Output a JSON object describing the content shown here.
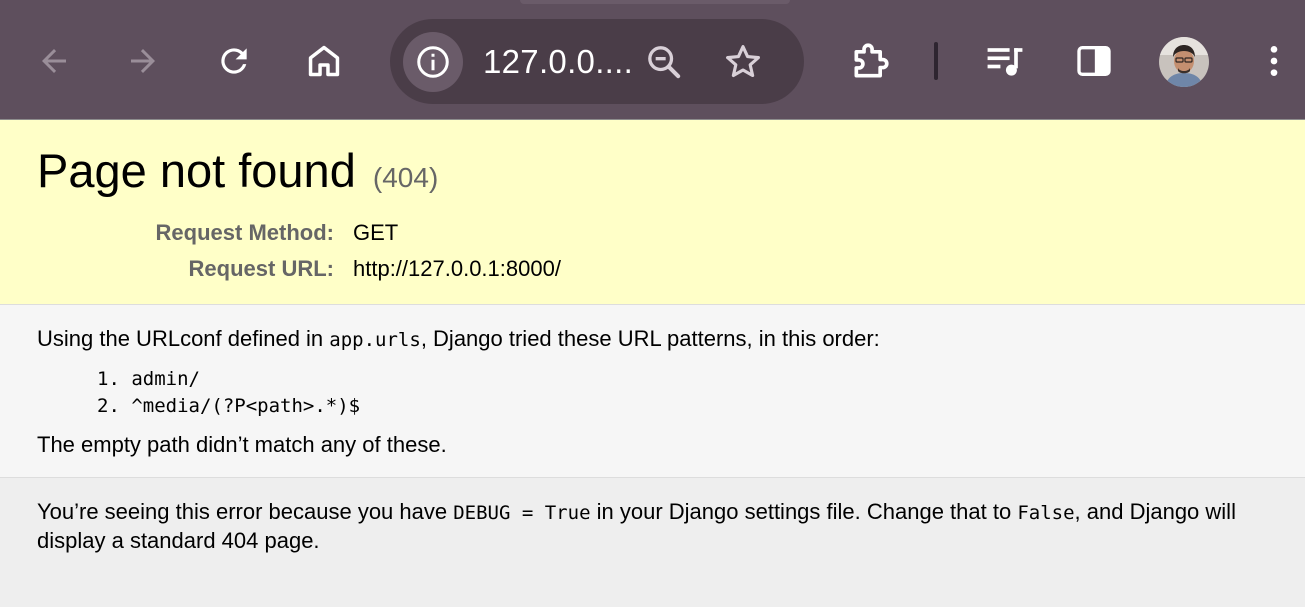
{
  "browser": {
    "address_text": "127.0.0....",
    "icons": [
      "back-arrow-icon",
      "forward-arrow-icon",
      "reload-icon",
      "home-icon",
      "info-icon",
      "zoom-out-icon",
      "star-icon",
      "extensions-icon",
      "media-playlist-icon",
      "side-panel-icon",
      "avatar",
      "menu-dots-icon"
    ],
    "colors": {
      "toolbar": "#5e4f5d",
      "omnibox": "#4a3d48"
    }
  },
  "error": {
    "title": "Page not found",
    "status": "(404)",
    "request_method_label": "Request Method:",
    "request_method": "GET",
    "request_url_label": "Request URL:",
    "request_url": "http://127.0.0.1:8000/"
  },
  "info": {
    "intro_before": "Using the URLconf defined in ",
    "intro_code": "app.urls",
    "intro_after": ", Django tried these URL patterns, in this order:",
    "patterns": [
      {
        "num": "1.",
        "text": "admin/"
      },
      {
        "num": "2.",
        "text": "^media/(?P<path>.*)$"
      }
    ],
    "no_match": "The empty path didn’t match any of these."
  },
  "explanation": {
    "part1": "You’re seeing this error because you have ",
    "code1": "DEBUG = True",
    "part2": " in your Django settings file. Change that to ",
    "code2": "False",
    "part3": ", and Django will display a standard 404 page."
  },
  "colors": {
    "summary_bg": "#ffffc8",
    "info_bg": "#f6f6f6",
    "explanation_bg": "#eeeeee",
    "label_gray": "#666666"
  }
}
